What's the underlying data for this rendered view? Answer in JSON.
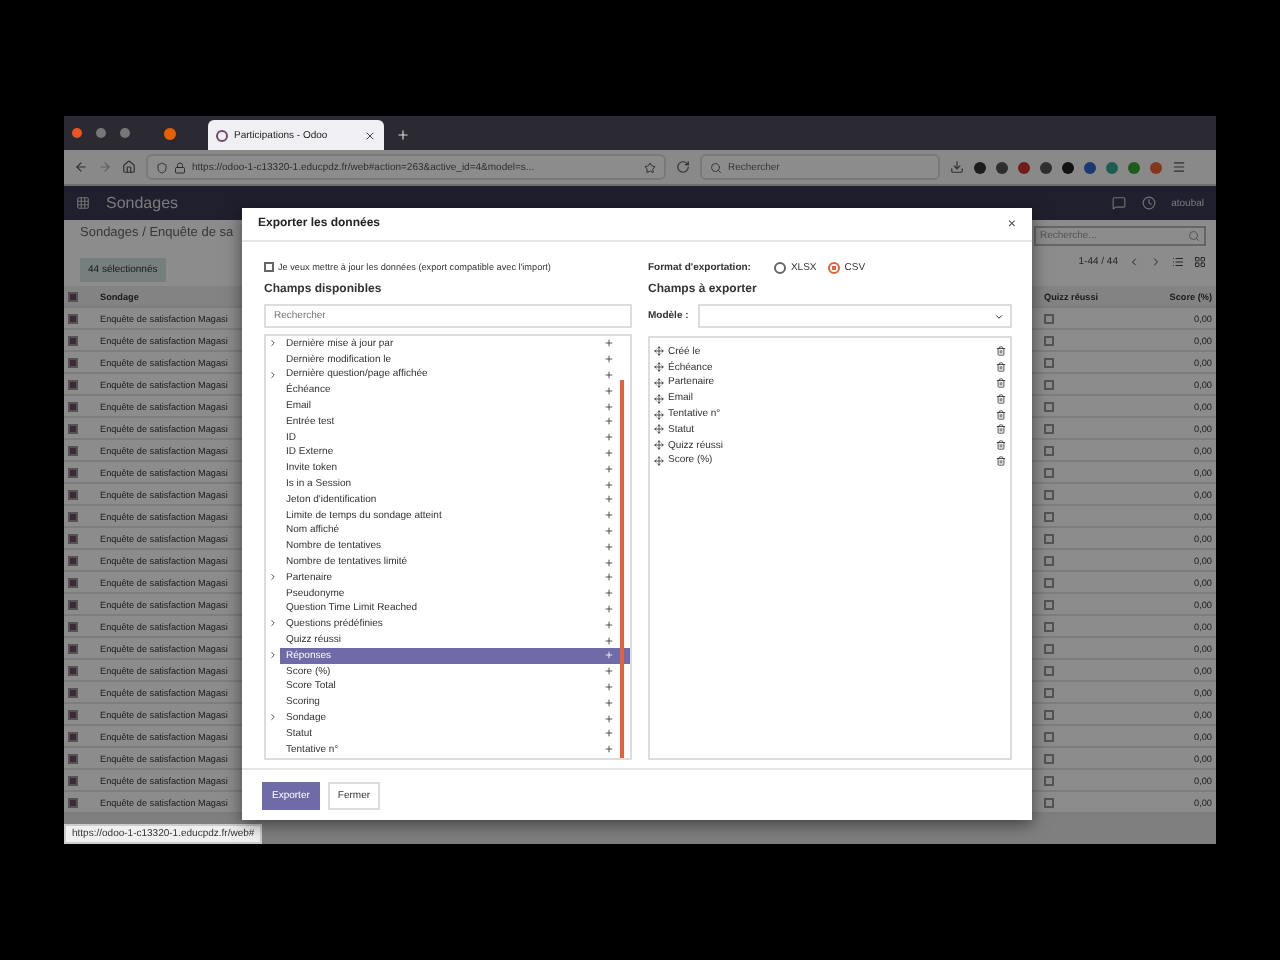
{
  "browser": {
    "tab_title": "Participations - Odoo",
    "url": "https://odoo-1-c13320-1.educpdz.fr/web#action=263&active_id=4&model=s...",
    "search_placeholder": "Rechercher",
    "status_link": "https://odoo-1-c13320-1.educpdz.fr/web#"
  },
  "navbar": {
    "app": "Sondages",
    "user": "atoubal"
  },
  "control_panel": {
    "breadcrumb": "Sondages / Enquête de sa",
    "selection": "44 sélectionnés",
    "search_placeholder": "Recherche...",
    "pager": "1-44 / 44"
  },
  "table": {
    "all_selected": true,
    "columns": [
      "Sondage",
      "Quizz réussi",
      "Score (%)"
    ],
    "rows": [
      {
        "sondage": "Enquête de satisfaction Magasi",
        "selected": true,
        "quizz_checked": false,
        "score": "0,00"
      },
      {
        "sondage": "Enquête de satisfaction Magasi",
        "selected": true,
        "quizz_checked": false,
        "score": "0,00"
      },
      {
        "sondage": "Enquête de satisfaction Magasi",
        "selected": true,
        "quizz_checked": false,
        "score": "0,00"
      },
      {
        "sondage": "Enquête de satisfaction Magasi",
        "selected": true,
        "quizz_checked": false,
        "score": "0,00"
      },
      {
        "sondage": "Enquête de satisfaction Magasi",
        "selected": true,
        "quizz_checked": false,
        "score": "0,00"
      },
      {
        "sondage": "Enquête de satisfaction Magasi",
        "selected": true,
        "quizz_checked": false,
        "score": "0,00"
      },
      {
        "sondage": "Enquête de satisfaction Magasi",
        "selected": true,
        "quizz_checked": false,
        "score": "0,00"
      },
      {
        "sondage": "Enquête de satisfaction Magasi",
        "selected": true,
        "quizz_checked": false,
        "score": "0,00"
      },
      {
        "sondage": "Enquête de satisfaction Magasi",
        "selected": true,
        "quizz_checked": false,
        "score": "0,00"
      },
      {
        "sondage": "Enquête de satisfaction Magasi",
        "selected": true,
        "quizz_checked": false,
        "score": "0,00"
      },
      {
        "sondage": "Enquête de satisfaction Magasi",
        "selected": true,
        "quizz_checked": false,
        "score": "0,00"
      },
      {
        "sondage": "Enquête de satisfaction Magasi",
        "selected": true,
        "quizz_checked": false,
        "score": "0,00"
      },
      {
        "sondage": "Enquête de satisfaction Magasi",
        "selected": true,
        "quizz_checked": false,
        "score": "0,00"
      },
      {
        "sondage": "Enquête de satisfaction Magasi",
        "selected": true,
        "quizz_checked": false,
        "score": "0,00"
      },
      {
        "sondage": "Enquête de satisfaction Magasi",
        "selected": true,
        "quizz_checked": false,
        "score": "0,00"
      },
      {
        "sondage": "Enquête de satisfaction Magasi",
        "selected": true,
        "quizz_checked": false,
        "score": "0,00"
      },
      {
        "sondage": "Enquête de satisfaction Magasi",
        "selected": true,
        "quizz_checked": false,
        "score": "0,00"
      },
      {
        "sondage": "Enquête de satisfaction Magasi",
        "selected": true,
        "quizz_checked": false,
        "score": "0,00"
      },
      {
        "sondage": "Enquête de satisfaction Magasi",
        "selected": true,
        "quizz_checked": false,
        "score": "0,00"
      },
      {
        "sondage": "Enquête de satisfaction Magasi",
        "selected": true,
        "quizz_checked": false,
        "score": "0,00"
      },
      {
        "sondage": "Enquête de satisfaction Magasi",
        "selected": true,
        "quizz_checked": false,
        "score": "0,00"
      },
      {
        "sondage": "Enquête de satisfaction Magasi",
        "selected": true,
        "quizz_checked": false,
        "score": "0,00"
      },
      {
        "sondage": "Enquête de satisfaction Magasi",
        "selected": true,
        "quizz_checked": false,
        "score": "0,00"
      }
    ]
  },
  "dialog": {
    "title": "Exporter les données",
    "close": "×",
    "compat_checkbox": {
      "label": "Je veux mettre à jour les données (export compatible avec l'import)",
      "checked": false
    },
    "available_title": "Champs disponibles",
    "search_placeholder": "Rechercher",
    "available_fields": [
      {
        "label": "Dernière mise à jour par",
        "expandable": true,
        "selected": false
      },
      {
        "label": "Dernière modification le",
        "expandable": false,
        "selected": false
      },
      {
        "label": "Dernière question/page affichée",
        "expandable": true,
        "selected": false
      },
      {
        "label": "Échéance",
        "expandable": false,
        "selected": false
      },
      {
        "label": "Email",
        "expandable": false,
        "selected": false
      },
      {
        "label": "Entrée test",
        "expandable": false,
        "selected": false
      },
      {
        "label": "ID",
        "expandable": false,
        "selected": false
      },
      {
        "label": "ID Externe",
        "expandable": false,
        "selected": false
      },
      {
        "label": "Invite token",
        "expandable": false,
        "selected": false
      },
      {
        "label": "Is in a Session",
        "expandable": false,
        "selected": false
      },
      {
        "label": "Jeton d'identification",
        "expandable": false,
        "selected": false
      },
      {
        "label": "Limite de temps du sondage atteint",
        "expandable": false,
        "selected": false
      },
      {
        "label": "Nom affiché",
        "expandable": false,
        "selected": false
      },
      {
        "label": "Nombre de tentatives",
        "expandable": false,
        "selected": false
      },
      {
        "label": "Nombre de tentatives limité",
        "expandable": false,
        "selected": false
      },
      {
        "label": "Partenaire",
        "expandable": true,
        "selected": false
      },
      {
        "label": "Pseudonyme",
        "expandable": false,
        "selected": false
      },
      {
        "label": "Question Time Limit Reached",
        "expandable": false,
        "selected": false
      },
      {
        "label": "Questions prédéfinies",
        "expandable": true,
        "selected": false
      },
      {
        "label": "Quizz réussi",
        "expandable": false,
        "selected": false
      },
      {
        "label": "Réponses",
        "expandable": true,
        "selected": true
      },
      {
        "label": "Score (%)",
        "expandable": false,
        "selected": false
      },
      {
        "label": "Score Total",
        "expandable": false,
        "selected": false
      },
      {
        "label": "Scoring",
        "expandable": false,
        "selected": false
      },
      {
        "label": "Sondage",
        "expandable": true,
        "selected": false
      },
      {
        "label": "Statut",
        "expandable": false,
        "selected": false
      },
      {
        "label": "Tentative n°",
        "expandable": false,
        "selected": false
      }
    ],
    "format_label": "Format d'exportation:",
    "formats": [
      {
        "label": "XLSX",
        "selected": false
      },
      {
        "label": "CSV",
        "selected": true
      }
    ],
    "export_title": "Champs à exporter",
    "template_label": "Modèle :",
    "export_fields": [
      "Créé le",
      "Échéance",
      "Partenaire",
      "Email",
      "Tentative n°",
      "Statut",
      "Quizz réussi",
      "Score (%)"
    ],
    "buttons": [
      {
        "label": "Exporter",
        "kind": "primary"
      },
      {
        "label": "Fermer",
        "kind": "secondary"
      }
    ]
  }
}
